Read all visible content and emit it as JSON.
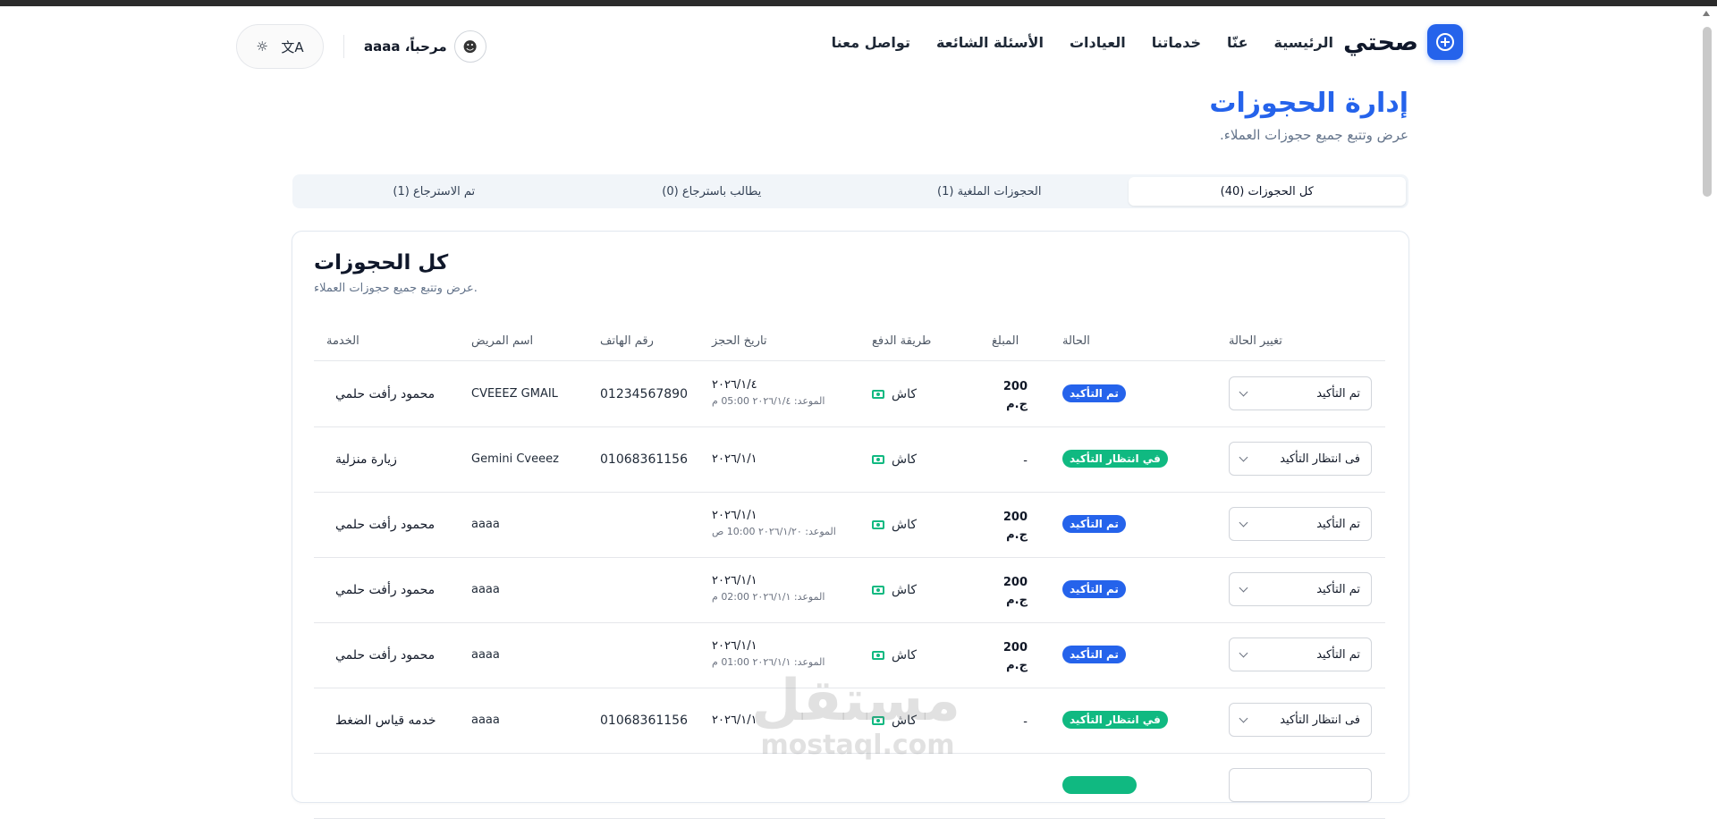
{
  "brand": {
    "name": "صحتي"
  },
  "nav": {
    "links": [
      "الرئيسية",
      "عنّا",
      "خدماتنا",
      "العيادات",
      "الأسئلة الشائعة",
      "تواصل معنا"
    ]
  },
  "user": {
    "greeting": "مرحباً، aaaa",
    "avatar_icon": "user-avatar-icon"
  },
  "tools": {
    "theme_icon": "sun-icon",
    "language_icon": "translate-icon"
  },
  "page": {
    "title": "إدارة الحجوزات",
    "subtitle": "عرض وتتبع جميع حجوزات العملاء."
  },
  "tabs": [
    {
      "label": "كل الحجوزات (40)",
      "active": true
    },
    {
      "label": "الحجوزات الملغية (1)",
      "active": false
    },
    {
      "label": "يطالب باسترجاع (0)",
      "active": false
    },
    {
      "label": "تم الاسترجاع (1)",
      "active": false
    }
  ],
  "card": {
    "title": "كل الحجوزات",
    "subtitle": ".عرض وتتبع جميع حجوزات العملاء"
  },
  "table": {
    "headers": {
      "service": "الخدمة",
      "patient": "اسم المريض",
      "phone": "رقم الهاتف",
      "date": "تاريخ الحجز",
      "payment": "طريقة الدفع",
      "amount": "المبلغ",
      "status": "الحالة",
      "change": "تغيير الحالة"
    },
    "rows": [
      {
        "service": "محمود رأفت حلمي",
        "patient": "CVEEEZ GMAIL",
        "phone": "01234567890",
        "date": "٢٠٢٦/١/٤",
        "appointment": "الموعد: ٢٠٢٦/١/٤ 05:00 م",
        "payment": "كاش",
        "amount": "200",
        "currency": "ج.م",
        "status": "تم التأكيد",
        "status_type": "confirmed",
        "select": "تم التأكيد"
      },
      {
        "service": "زيارة منزلية",
        "patient": "Gemini Cveeez",
        "phone": "01068361156",
        "date": "٢٠٢٦/١/١",
        "appointment": "",
        "payment": "كاش",
        "amount": "-",
        "currency": "",
        "status": "في انتظار التأكيد",
        "status_type": "pending",
        "select": "فى انتظار التأكيد"
      },
      {
        "service": "محمود رأفت حلمي",
        "patient": "aaaa",
        "phone": "",
        "date": "٢٠٢٦/١/١",
        "appointment": "الموعد: ٢٠٢٦/١/٢٠ 10:00 ص",
        "payment": "كاش",
        "amount": "200",
        "currency": "ج.م",
        "status": "تم التأكيد",
        "status_type": "confirmed",
        "select": "تم التأكيد"
      },
      {
        "service": "محمود رأفت حلمي",
        "patient": "aaaa",
        "phone": "",
        "date": "٢٠٢٦/١/١",
        "appointment": "الموعد: ٢٠٢٦/١/١ 02:00 م",
        "payment": "كاش",
        "amount": "200",
        "currency": "ج.م",
        "status": "تم التأكيد",
        "status_type": "confirmed",
        "select": "تم التأكيد"
      },
      {
        "service": "محمود رأفت حلمي",
        "patient": "aaaa",
        "phone": "",
        "date": "٢٠٢٦/١/١",
        "appointment": "الموعد: ٢٠٢٦/١/١ 01:00 م",
        "payment": "كاش",
        "amount": "200",
        "currency": "ج.م",
        "status": "تم التأكيد",
        "status_type": "confirmed",
        "select": "تم التأكيد"
      },
      {
        "service": "خدمه قياس الضغط",
        "patient": "aaaa",
        "phone": "01068361156",
        "date": "٢٠٢٦/١/١",
        "appointment": "",
        "payment": "كاش",
        "amount": "-",
        "currency": "",
        "status": "في انتظار التأكيد",
        "status_type": "pending",
        "select": "فى انتظار التأكيد"
      }
    ]
  },
  "watermark": {
    "arabic": "مستقل",
    "latin": "mostaql.com"
  },
  "colors": {
    "primary": "#2563eb",
    "success": "#10b981",
    "muted": "#64748b"
  }
}
